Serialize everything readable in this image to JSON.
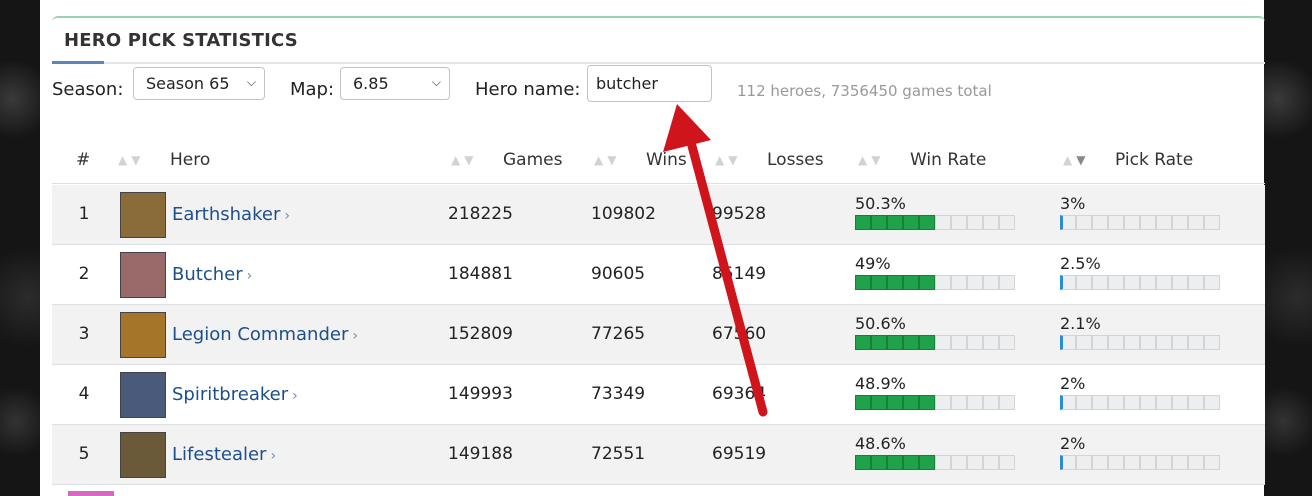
{
  "page": {
    "title": "HERO PICK STATISTICS"
  },
  "filters": {
    "season_label": "Season:",
    "season_value": "Season 65",
    "map_label": "Map:",
    "map_value": "6.85",
    "hero_name_label": "Hero name:",
    "hero_name_value": "butcher",
    "total_text": "112 heroes, 7356450 games total"
  },
  "columns": {
    "rank": "#",
    "hero": "Hero",
    "games": "Games",
    "wins": "Wins",
    "losses": "Losses",
    "win_rate": "Win Rate",
    "pick_rate": "Pick Rate"
  },
  "rows": [
    {
      "rank": "1",
      "hero": "Earthshaker",
      "games": "218225",
      "wins": "109802",
      "losses": "99528",
      "win_rate": "50.3%",
      "win_rate_filled": 5,
      "pick_rate": "3%",
      "avatar_color": "#8a6b3a"
    },
    {
      "rank": "2",
      "hero": "Butcher",
      "games": "184881",
      "wins": "90605",
      "losses": "85149",
      "win_rate": "49%",
      "win_rate_filled": 5,
      "pick_rate": "2.5%",
      "avatar_color": "#9a6a6a"
    },
    {
      "rank": "3",
      "hero": "Legion Commander",
      "games": "152809",
      "wins": "77265",
      "losses": "67560",
      "win_rate": "50.6%",
      "win_rate_filled": 5,
      "pick_rate": "2.1%",
      "avatar_color": "#a5752a"
    },
    {
      "rank": "4",
      "hero": "Spiritbreaker",
      "games": "149993",
      "wins": "73349",
      "losses": "69364",
      "win_rate": "48.9%",
      "win_rate_filled": 5,
      "pick_rate": "2%",
      "avatar_color": "#4a5a7a"
    },
    {
      "rank": "5",
      "hero": "Lifestealer",
      "games": "149188",
      "wins": "72551",
      "losses": "69519",
      "win_rate": "48.6%",
      "win_rate_filled": 5,
      "pick_rate": "2%",
      "avatar_color": "#6a5a3a"
    }
  ],
  "colors": {
    "link": "#1d4f8c",
    "win_bar": "#1fa24a",
    "pick_bar": "#2a8ed4",
    "annotation_arrow": "#d0141c"
  },
  "icons": {
    "sort_asc": "sort-asc-icon",
    "sort_desc": "sort-desc-icon",
    "chevron": "chevron-right-icon",
    "dropdown": "chevron-down-icon"
  }
}
